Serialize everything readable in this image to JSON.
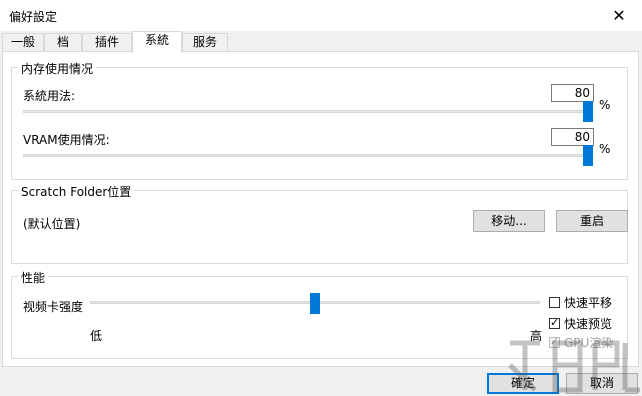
{
  "window": {
    "title": "偏好設定",
    "close_label": "✕"
  },
  "tabs": [
    "一般",
    "档",
    "插件",
    "系統",
    "服务"
  ],
  "memory": {
    "group_label": "内存使用情况",
    "system_label": "系統用法:",
    "system_value": "80",
    "vram_label": "VRAM使用情况:",
    "vram_value": "80",
    "unit": "%",
    "system_level_percent": 80,
    "vram_level_percent": 80
  },
  "scratch": {
    "group_label": "Scratch Folder位置",
    "path": "(默认位置)",
    "move_label": "移动...",
    "restart_label": "重启"
  },
  "performance": {
    "group_label": "性能",
    "slider_label": "视频卡强度",
    "low_label": "低",
    "high_label": "高",
    "slider_level_percent": 50,
    "fast_pan_label": "快速平移",
    "fast_preview_label": "快速预览",
    "gpu_render_label": "GPU渲染"
  },
  "footer": {
    "ok_label": "確定",
    "cancel_label": "取消"
  },
  "colors": {
    "accent": "#0078d7"
  }
}
